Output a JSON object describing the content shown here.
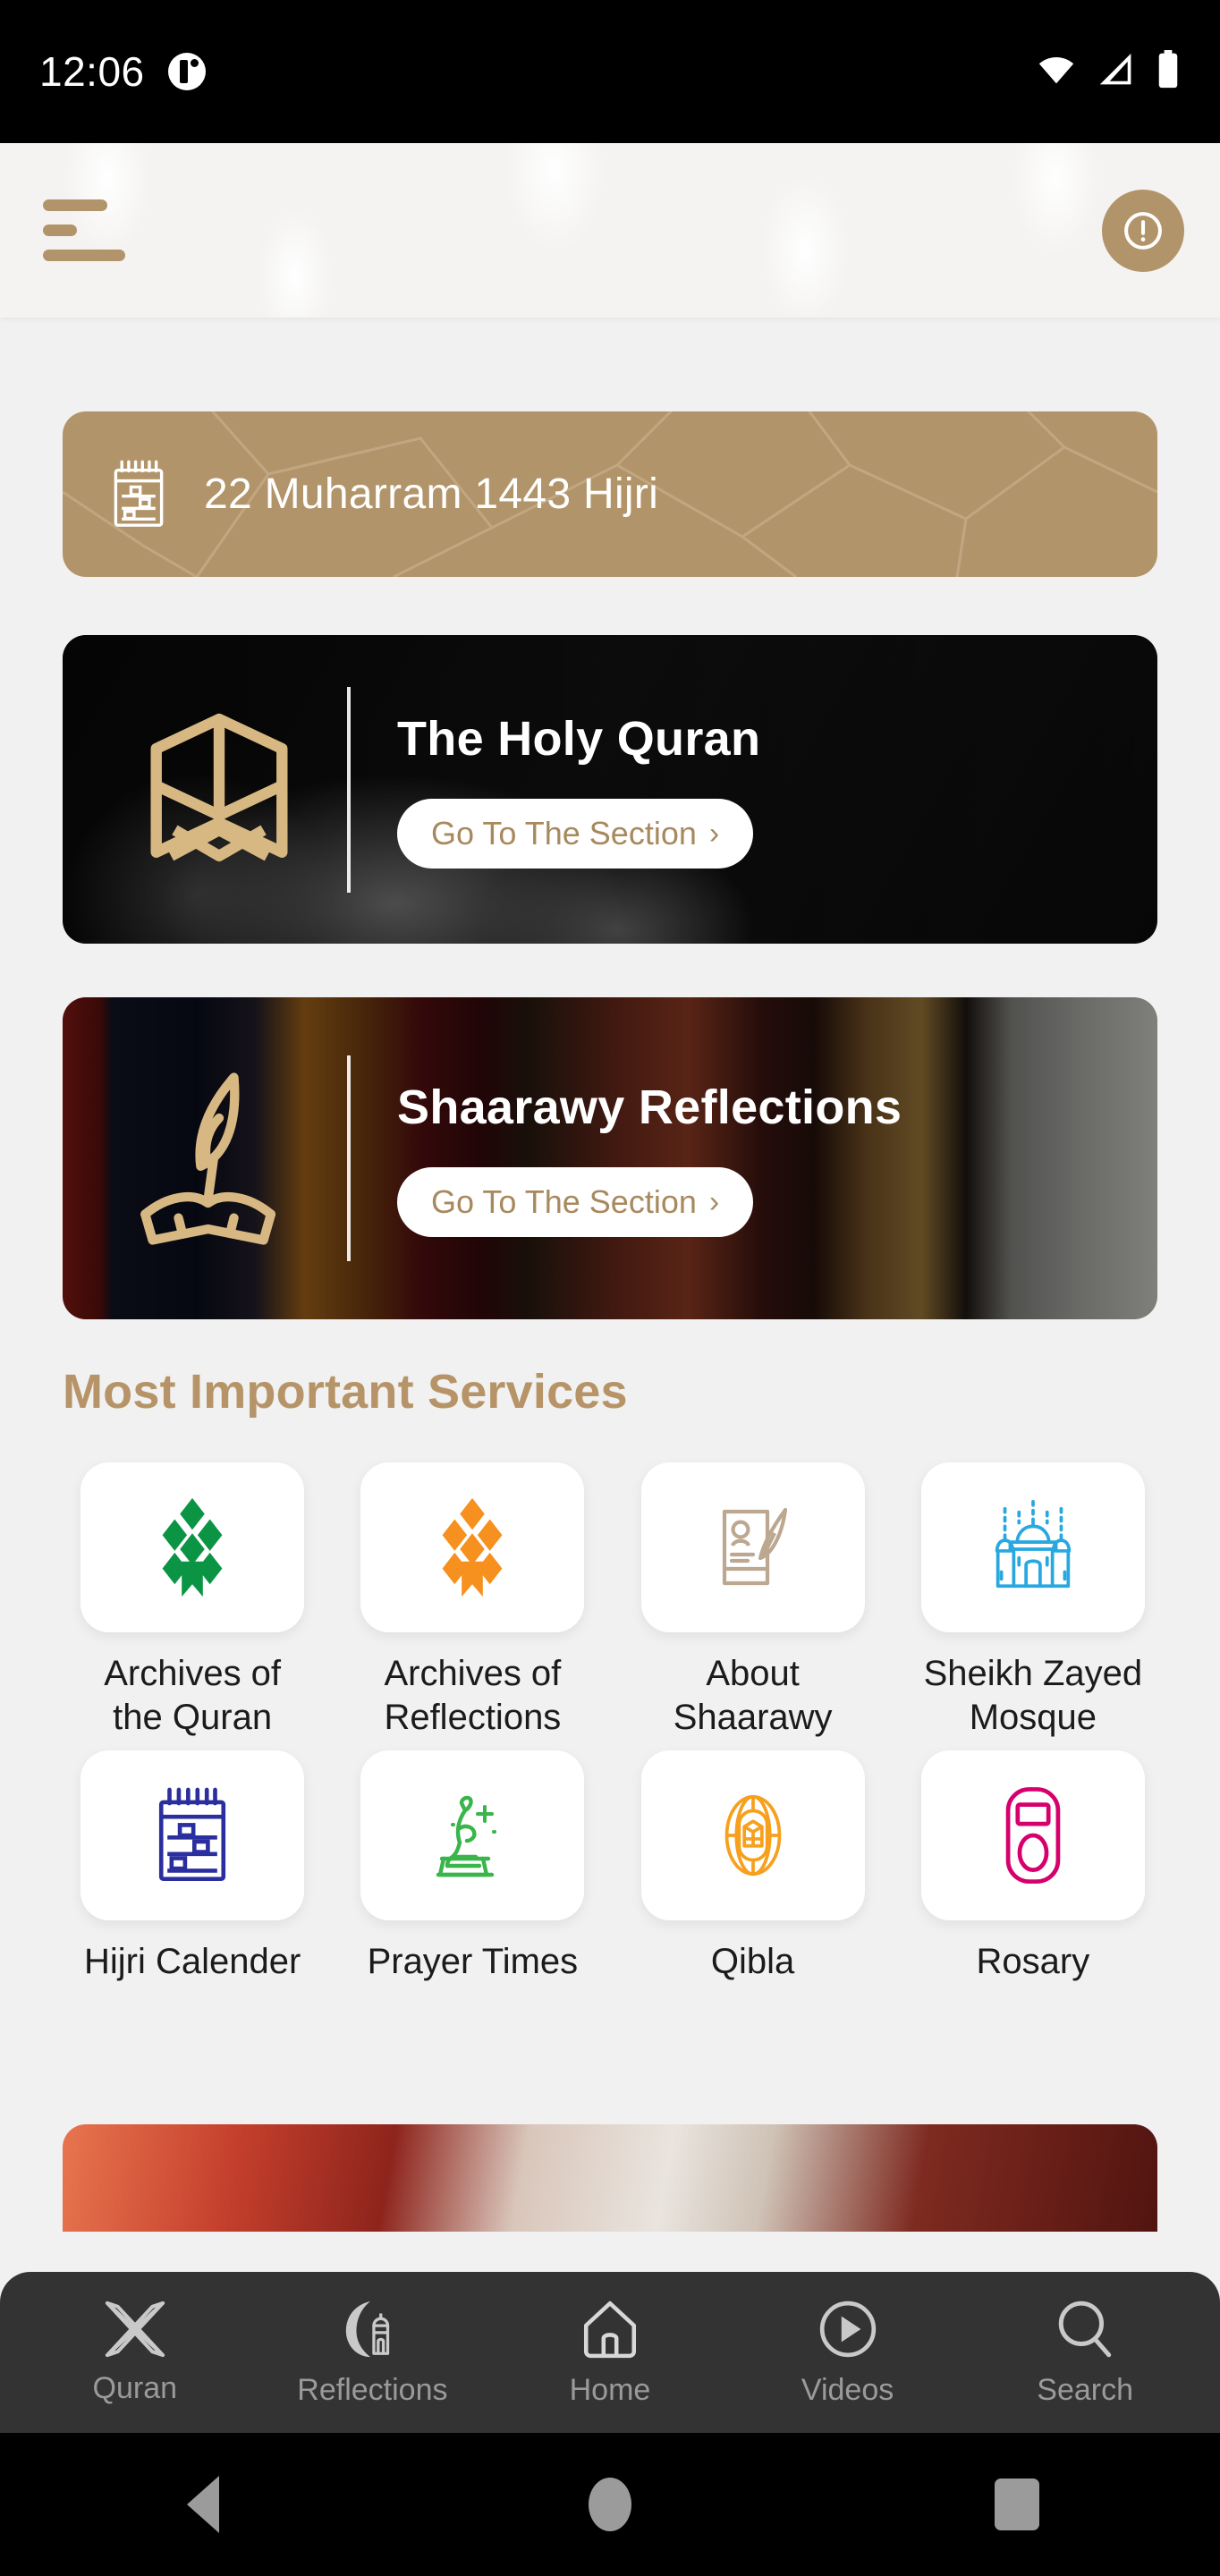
{
  "status_bar": {
    "time": "12:06",
    "notification_icon": "notification-dot-icon",
    "wifi_icon": "wifi-icon",
    "signal_icon": "cellular-signal-icon",
    "battery_icon": "battery-full-icon"
  },
  "header": {
    "menu_icon": "hamburger-menu-icon",
    "info_icon": "info-alert-icon",
    "accent_color": "#B2946A"
  },
  "hijri_banner": {
    "icon": "hijri-calendar-icon",
    "text": "22 Muharram 1443 Hijri",
    "background_color": "#B2946A",
    "text_color": "#FFFFFF"
  },
  "feature_cards": [
    {
      "id": "holy-quran",
      "title": "The Holy Quran",
      "button_label": "Go To The Section",
      "button_chevron": "chevron-right-icon",
      "logo_icon": "open-quran-book-icon",
      "logo_color": "#D8B882"
    },
    {
      "id": "shaarawy-reflections",
      "title": "Shaarawy Reflections",
      "button_label": "Go To The Section",
      "button_chevron": "chevron-right-icon",
      "logo_icon": "quill-and-book-icon",
      "logo_color": "#D8B882"
    }
  ],
  "services": {
    "title": "Most Important Services",
    "title_color": "#B69468",
    "items": [
      {
        "label": "Archives of\nthe Quran",
        "icon": "diamond-bookmark-icon",
        "color": "#0B9444"
      },
      {
        "label": "Archives of\nReflections",
        "icon": "diamond-bookmark-icon",
        "color": "#F6901E"
      },
      {
        "label": "About\nShaarawy",
        "icon": "document-quill-icon",
        "color": "#BCA891"
      },
      {
        "label": "Sheikh Zayed\nMosque",
        "icon": "mosque-icon",
        "color": "#29A8E0"
      },
      {
        "label": "Hijri\nCalender",
        "icon": "calendar-icon",
        "color": "#2B2E9E"
      },
      {
        "label": "Prayer Times",
        "icon": "praying-person-icon",
        "color": "#39B54A"
      },
      {
        "label": "Qibla",
        "icon": "qibla-compass-icon",
        "color": "#F6A01E"
      },
      {
        "label": "Rosary",
        "icon": "rosary-counter-icon",
        "color": "#D6006D"
      }
    ]
  },
  "bottom_nav": {
    "background_color": "#333333",
    "items": [
      {
        "label": "Quran",
        "icon": "crossed-rihal-icon",
        "active": false
      },
      {
        "label": "Reflections",
        "icon": "crescent-mosque-icon",
        "active": false
      },
      {
        "label": "Home",
        "icon": "home-icon",
        "active": true
      },
      {
        "label": "Videos",
        "icon": "play-circle-icon",
        "active": false
      },
      {
        "label": "Search",
        "icon": "search-icon",
        "active": false
      }
    ]
  },
  "android_nav": {
    "back_icon": "android-back-icon",
    "home_icon": "android-home-icon",
    "recents_icon": "android-recents-icon"
  }
}
